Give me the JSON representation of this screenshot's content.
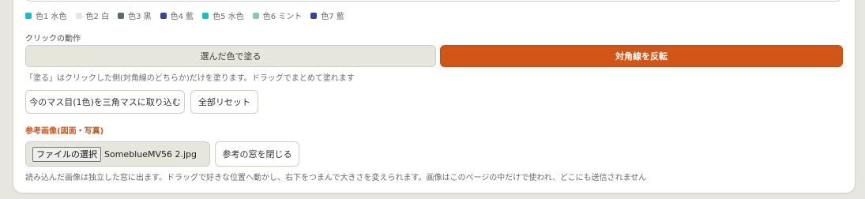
{
  "legend": [
    {
      "label": "色1 水色",
      "color": "#17bcd0"
    },
    {
      "label": "色2 白",
      "color": "#e6e6e6"
    },
    {
      "label": "色3 黒",
      "color": "#5b6b73"
    },
    {
      "label": "色4 藍",
      "color": "#35459c"
    },
    {
      "label": "色5 水色",
      "color": "#17bcd0"
    },
    {
      "label": "色6 ミント",
      "color": "#7fcbc2"
    },
    {
      "label": "色7 藍",
      "color": "#35459c"
    }
  ],
  "click_action": {
    "label": "クリックの動作",
    "paint_label": "選んだ色で塗る",
    "flip_label": "対角線を反転",
    "selected": "flip",
    "hint": "「塗る」はクリックした側(対角線のどちらか)だけを塗ります。ドラッグでまとめて塗れます"
  },
  "actions": {
    "triangle_label": "今のマス目(1色)を三角マスに取り込む",
    "reset_label": "全部リセット"
  },
  "reference": {
    "title": "参考画像(図面・写真)",
    "file_button_label": "ファイルの選択",
    "file_name": "SomeblueMV56 2.jpg",
    "close_label": "参考の窓を閉じる",
    "hint": "読み込んだ画像は独立した窓に出ます。ドラッグで好きな位置へ動かし、右下をつまんで大きさを変えられます。画像はこのページの中だけで使われ、どこにも送信されません"
  },
  "colors": {
    "accent": "#d15516",
    "background": "#e7e6df"
  }
}
